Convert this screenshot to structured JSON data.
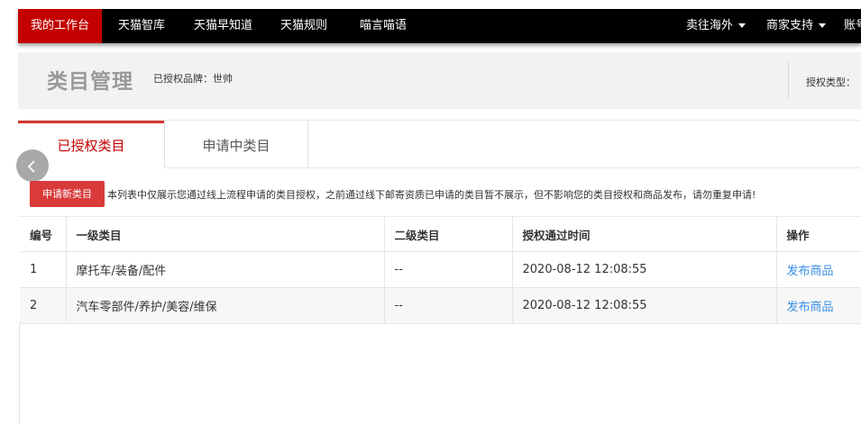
{
  "nav": {
    "items": [
      {
        "label": "我的工作台"
      },
      {
        "label": "天猫智库"
      },
      {
        "label": "天猫早知道"
      },
      {
        "label": "天猫规则"
      },
      {
        "label": "喵言喵语"
      }
    ],
    "right_items": [
      {
        "label": "卖往海外"
      },
      {
        "label": "商家支持"
      },
      {
        "label": "账号"
      }
    ],
    "active_color": "#c40000"
  },
  "header": {
    "title": "类目管理",
    "brand_info": "已授权品牌：世帅",
    "auth_type": "授权类型："
  },
  "tabs": [
    {
      "label": "已授权类目"
    },
    {
      "label": "申请中类目"
    }
  ],
  "toolbar": {
    "back_icon": "chevron-left-icon",
    "apply_label": "申请新类目",
    "notice": "本列表中仅展示您通过线上流程申请的类目授权，之前通过线下邮寄资质已申请的类目暂不展示，但不影响您的类目授权和商品发布，请勿重复申请!"
  },
  "table": {
    "headers": [
      "编号",
      "一级类目",
      "二级类目",
      "授权通过时间",
      "操作"
    ],
    "rows": [
      {
        "id": "1",
        "cat1": "摩托车/装备/配件",
        "cat2": "--",
        "time": "2020-08-12 12:08:55",
        "action": "发布商品"
      },
      {
        "id": "2",
        "cat1": "汽车零部件/养护/美容/维保",
        "cat2": "--",
        "time": "2020-08-12 12:08:55",
        "action": "发布商品"
      }
    ]
  },
  "colors": {
    "primary_red": "#d93a3a",
    "link_blue": "#3a8ee6"
  }
}
